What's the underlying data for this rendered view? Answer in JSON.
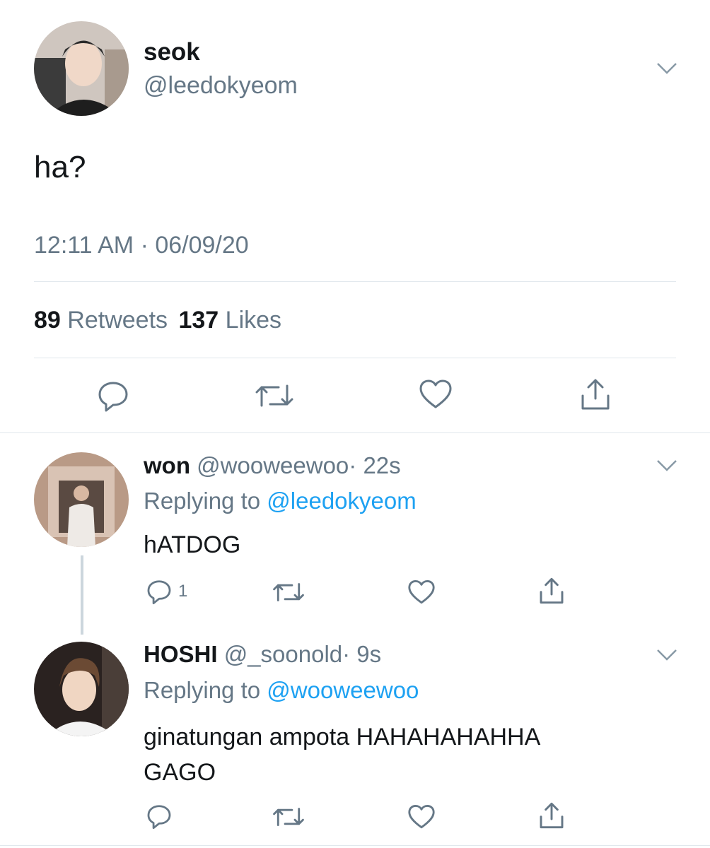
{
  "main_tweet": {
    "display_name": "seok",
    "handle": "@leedokyeom",
    "text": "ha?",
    "timestamp": "12:11 AM · 06/09/20",
    "retweets_count": "89",
    "retweets_label": "Retweets",
    "likes_count": "137",
    "likes_label": "Likes"
  },
  "replies": [
    {
      "display_name": "won",
      "handle": "@wooweewoo",
      "time": "· 22s",
      "replying_prefix": "Replying to",
      "replying_to": "@leedokyeom",
      "text": "hATDOG",
      "reply_count": "1"
    },
    {
      "display_name": "HOSHI",
      "handle": "@_soonold",
      "time": "· 9s",
      "replying_prefix": "Replying to",
      "replying_to": "@wooweewoo",
      "text_line1": "ginatungan ampota HAHAHAHAHHA",
      "text_line2": "GAGO"
    }
  ],
  "colors": {
    "accent": "#1da1f2",
    "muted": "#657786",
    "icon": "#657786",
    "divider": "#e1e8ed"
  }
}
